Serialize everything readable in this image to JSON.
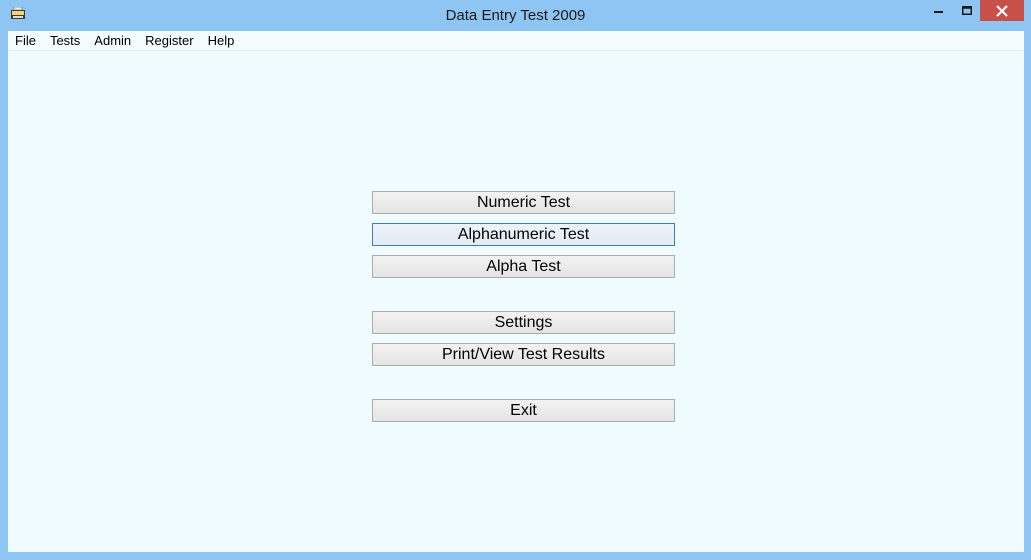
{
  "window": {
    "title": "Data Entry Test 2009",
    "controls": {
      "minimize_icon": "minimize-icon",
      "maximize_icon": "maximize-icon",
      "close_icon": "close-icon"
    },
    "close_color": "#c7504b",
    "frame_color": "#8ec5f2"
  },
  "menu": {
    "items": [
      {
        "label": "File"
      },
      {
        "label": "Tests"
      },
      {
        "label": "Admin"
      },
      {
        "label": "Register"
      },
      {
        "label": "Help"
      }
    ]
  },
  "main": {
    "buttons": [
      {
        "label": "Numeric Test"
      },
      {
        "label": "Alphanumeric Test",
        "focused": true
      },
      {
        "label": "Alpha Test"
      },
      {
        "label": "Settings"
      },
      {
        "label": "Print/View Test Results"
      },
      {
        "label": "Exit"
      }
    ],
    "background": "#f0fbff"
  }
}
